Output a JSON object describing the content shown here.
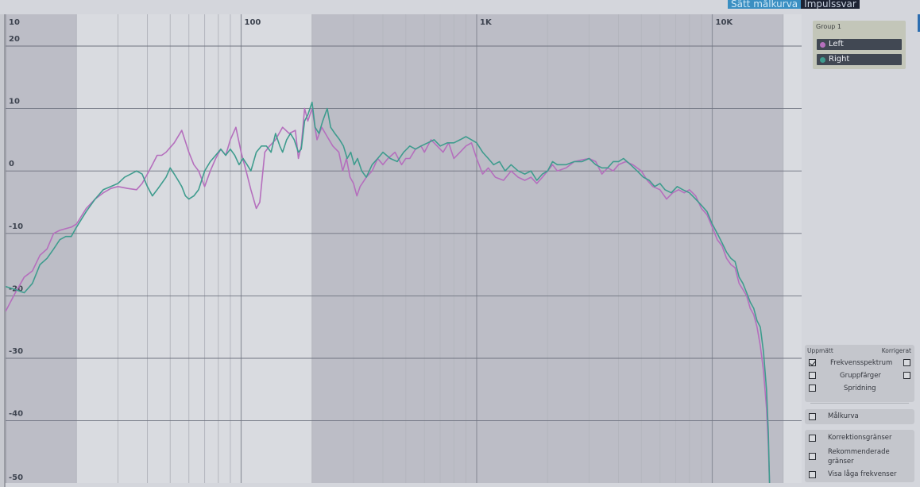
{
  "toolbar": {
    "target_curve_label": "Sätt målkurva",
    "impulse_label": "Impulssvar"
  },
  "chart_data": {
    "type": "line",
    "xscale": "log",
    "xlim": [
      10,
      20000
    ],
    "ylim": [
      -50,
      20
    ],
    "grid": true,
    "x_ticks": [
      {
        "value": 10,
        "label": "10"
      },
      {
        "value": 100,
        "label": "100"
      },
      {
        "value": 1000,
        "label": "1K"
      },
      {
        "value": 10000,
        "label": "10K"
      }
    ],
    "y_ticks": [
      {
        "value": 20,
        "label": "20"
      },
      {
        "value": 10,
        "label": "10"
      },
      {
        "value": 0,
        "label": "0"
      },
      {
        "value": -10,
        "label": "-10"
      },
      {
        "value": -20,
        "label": "-20"
      },
      {
        "value": -30,
        "label": "-30"
      },
      {
        "value": -40,
        "label": "-40"
      },
      {
        "value": -50,
        "label": "-50"
      }
    ],
    "shaded_regions": [
      [
        10,
        20
      ],
      [
        200,
        20000
      ]
    ],
    "series": [
      {
        "name": "Left",
        "color": "#b56fbd",
        "points": [
          [
            10,
            -22.5
          ],
          [
            11,
            -19.5
          ],
          [
            12,
            -17
          ],
          [
            13,
            -16
          ],
          [
            14,
            -13.5
          ],
          [
            15,
            -12.5
          ],
          [
            16,
            -10
          ],
          [
            17,
            -9.5
          ],
          [
            19,
            -9
          ],
          [
            20,
            -8.5
          ],
          [
            22,
            -6
          ],
          [
            24,
            -4.5
          ],
          [
            26,
            -3.5
          ],
          [
            28,
            -2.8
          ],
          [
            30,
            -2.5
          ],
          [
            33,
            -2.8
          ],
          [
            36,
            -3
          ],
          [
            38,
            -2
          ],
          [
            40,
            -0.5
          ],
          [
            42,
            1
          ],
          [
            44,
            2.5
          ],
          [
            46,
            2.5
          ],
          [
            48,
            3
          ],
          [
            52,
            4.5
          ],
          [
            56,
            6.5
          ],
          [
            60,
            3
          ],
          [
            63,
            1
          ],
          [
            66,
            0
          ],
          [
            70,
            -2.5
          ],
          [
            74,
            0
          ],
          [
            78,
            2
          ],
          [
            82,
            3.5
          ],
          [
            86,
            2.5
          ],
          [
            90,
            5
          ],
          [
            95,
            7
          ],
          [
            100,
            3
          ],
          [
            105,
            0
          ],
          [
            110,
            -3
          ],
          [
            116,
            -6
          ],
          [
            120,
            -5
          ],
          [
            126,
            3
          ],
          [
            132,
            4
          ],
          [
            140,
            5
          ],
          [
            150,
            7
          ],
          [
            160,
            6
          ],
          [
            170,
            6.5
          ],
          [
            175,
            2
          ],
          [
            180,
            4
          ],
          [
            186,
            10
          ],
          [
            192,
            8
          ],
          [
            200,
            10
          ],
          [
            210,
            5
          ],
          [
            220,
            7
          ],
          [
            232,
            5.5
          ],
          [
            245,
            4
          ],
          [
            260,
            3
          ],
          [
            270,
            0
          ],
          [
            280,
            2
          ],
          [
            290,
            -1
          ],
          [
            300,
            -2
          ],
          [
            310,
            -4
          ],
          [
            320,
            -2.5
          ],
          [
            340,
            -1
          ],
          [
            360,
            0
          ],
          [
            380,
            2
          ],
          [
            400,
            1
          ],
          [
            420,
            2
          ],
          [
            450,
            3
          ],
          [
            480,
            1
          ],
          [
            500,
            2
          ],
          [
            520,
            2
          ],
          [
            550,
            3.5
          ],
          [
            580,
            4
          ],
          [
            600,
            3
          ],
          [
            640,
            5
          ],
          [
            680,
            4
          ],
          [
            720,
            3
          ],
          [
            760,
            4.5
          ],
          [
            800,
            2
          ],
          [
            850,
            3
          ],
          [
            900,
            4
          ],
          [
            950,
            4.5
          ],
          [
            1000,
            2
          ],
          [
            1060,
            -0.5
          ],
          [
            1120,
            0.5
          ],
          [
            1200,
            -1
          ],
          [
            1300,
            -1.5
          ],
          [
            1400,
            0
          ],
          [
            1500,
            -1
          ],
          [
            1600,
            -1.5
          ],
          [
            1700,
            -1
          ],
          [
            1800,
            -2
          ],
          [
            1900,
            -1
          ],
          [
            2000,
            0
          ],
          [
            2100,
            1
          ],
          [
            2200,
            0
          ],
          [
            2400,
            0.5
          ],
          [
            2600,
            1.5
          ],
          [
            2800,
            1.8
          ],
          [
            3000,
            2
          ],
          [
            3200,
            1.5
          ],
          [
            3400,
            -0.5
          ],
          [
            3600,
            0.5
          ],
          [
            3800,
            0
          ],
          [
            4000,
            1
          ],
          [
            4300,
            1.5
          ],
          [
            4600,
            1
          ],
          [
            5000,
            0
          ],
          [
            5300,
            -1.5
          ],
          [
            5600,
            -2.5
          ],
          [
            6000,
            -3
          ],
          [
            6400,
            -4.5
          ],
          [
            6800,
            -3.5
          ],
          [
            7200,
            -3
          ],
          [
            7600,
            -3.5
          ],
          [
            8000,
            -3
          ],
          [
            8500,
            -4
          ],
          [
            9000,
            -6
          ],
          [
            9500,
            -7
          ],
          [
            10000,
            -9
          ],
          [
            10500,
            -11
          ],
          [
            11000,
            -12
          ],
          [
            11500,
            -14
          ],
          [
            12000,
            -15
          ],
          [
            12500,
            -15.5
          ],
          [
            13000,
            -18
          ],
          [
            13500,
            -19
          ],
          [
            14000,
            -20
          ],
          [
            14500,
            -22
          ],
          [
            15000,
            -23
          ],
          [
            15500,
            -25
          ],
          [
            16000,
            -28
          ],
          [
            16500,
            -32
          ],
          [
            17000,
            -38
          ],
          [
            17300,
            -44
          ],
          [
            17500,
            -50
          ]
        ]
      },
      {
        "name": "Right",
        "color": "#3f9c8e",
        "points": [
          [
            10,
            -18.5
          ],
          [
            11,
            -19
          ],
          [
            12,
            -19.5
          ],
          [
            13,
            -18
          ],
          [
            14,
            -15
          ],
          [
            15,
            -14
          ],
          [
            16,
            -12.5
          ],
          [
            17,
            -11
          ],
          [
            18,
            -10.5
          ],
          [
            19,
            -10.5
          ],
          [
            20,
            -9
          ],
          [
            22,
            -6.5
          ],
          [
            24,
            -4.5
          ],
          [
            26,
            -3
          ],
          [
            28,
            -2.5
          ],
          [
            30,
            -2
          ],
          [
            32,
            -1
          ],
          [
            34,
            -0.5
          ],
          [
            36,
            0
          ],
          [
            38,
            -0.5
          ],
          [
            40,
            -2.5
          ],
          [
            42,
            -4
          ],
          [
            44,
            -3
          ],
          [
            46,
            -2
          ],
          [
            48,
            -1
          ],
          [
            50,
            0.5
          ],
          [
            52,
            -0.5
          ],
          [
            54,
            -1.5
          ],
          [
            56,
            -2.5
          ],
          [
            58,
            -4
          ],
          [
            60,
            -4.5
          ],
          [
            63,
            -4
          ],
          [
            66,
            -3
          ],
          [
            70,
            0
          ],
          [
            74,
            1.5
          ],
          [
            78,
            2.5
          ],
          [
            82,
            3.5
          ],
          [
            86,
            2.5
          ],
          [
            90,
            3.5
          ],
          [
            94,
            2.5
          ],
          [
            98,
            1
          ],
          [
            102,
            2
          ],
          [
            106,
            1
          ],
          [
            110,
            0
          ],
          [
            116,
            3
          ],
          [
            122,
            4
          ],
          [
            128,
            4
          ],
          [
            134,
            3
          ],
          [
            140,
            6
          ],
          [
            146,
            4
          ],
          [
            150,
            3
          ],
          [
            156,
            5
          ],
          [
            162,
            6
          ],
          [
            168,
            5
          ],
          [
            175,
            3
          ],
          [
            180,
            3.5
          ],
          [
            186,
            8
          ],
          [
            192,
            9
          ],
          [
            200,
            11
          ],
          [
            206,
            7
          ],
          [
            214,
            6
          ],
          [
            222,
            8
          ],
          [
            232,
            10
          ],
          [
            240,
            7
          ],
          [
            250,
            6
          ],
          [
            262,
            5
          ],
          [
            272,
            4
          ],
          [
            282,
            2
          ],
          [
            292,
            3
          ],
          [
            302,
            1
          ],
          [
            312,
            2
          ],
          [
            325,
            0
          ],
          [
            340,
            -1
          ],
          [
            360,
            1
          ],
          [
            380,
            2
          ],
          [
            400,
            3
          ],
          [
            430,
            2
          ],
          [
            460,
            1.5
          ],
          [
            490,
            3
          ],
          [
            520,
            4
          ],
          [
            550,
            3.5
          ],
          [
            580,
            4
          ],
          [
            620,
            4.5
          ],
          [
            660,
            5
          ],
          [
            700,
            4
          ],
          [
            750,
            4.5
          ],
          [
            800,
            4.5
          ],
          [
            850,
            5
          ],
          [
            900,
            5.5
          ],
          [
            950,
            5
          ],
          [
            1000,
            4.5
          ],
          [
            1060,
            3
          ],
          [
            1120,
            2
          ],
          [
            1180,
            1
          ],
          [
            1250,
            1.5
          ],
          [
            1320,
            0
          ],
          [
            1400,
            1
          ],
          [
            1500,
            0
          ],
          [
            1600,
            -0.5
          ],
          [
            1700,
            0
          ],
          [
            1800,
            -1.5
          ],
          [
            1900,
            -0.5
          ],
          [
            2000,
            0
          ],
          [
            2100,
            1.5
          ],
          [
            2200,
            1
          ],
          [
            2400,
            1
          ],
          [
            2600,
            1.5
          ],
          [
            2800,
            1.5
          ],
          [
            3000,
            2
          ],
          [
            3200,
            1
          ],
          [
            3400,
            0.5
          ],
          [
            3600,
            0.5
          ],
          [
            3800,
            1.5
          ],
          [
            4000,
            1.5
          ],
          [
            4200,
            2
          ],
          [
            4500,
            1
          ],
          [
            4800,
            0
          ],
          [
            5100,
            -1
          ],
          [
            5400,
            -1.5
          ],
          [
            5700,
            -2.5
          ],
          [
            6000,
            -2
          ],
          [
            6300,
            -3
          ],
          [
            6700,
            -3.5
          ],
          [
            7100,
            -2.5
          ],
          [
            7500,
            -3
          ],
          [
            8000,
            -3.5
          ],
          [
            8500,
            -4.5
          ],
          [
            9000,
            -5.5
          ],
          [
            9500,
            -6.5
          ],
          [
            10000,
            -8.5
          ],
          [
            10500,
            -10
          ],
          [
            11000,
            -11.5
          ],
          [
            11500,
            -13
          ],
          [
            12000,
            -14
          ],
          [
            12500,
            -14.5
          ],
          [
            13000,
            -17
          ],
          [
            13500,
            -18
          ],
          [
            14000,
            -19.5
          ],
          [
            14500,
            -21
          ],
          [
            15000,
            -22
          ],
          [
            15500,
            -24
          ],
          [
            16000,
            -25
          ],
          [
            16500,
            -29
          ],
          [
            17000,
            -35
          ],
          [
            17300,
            -42
          ],
          [
            17500,
            -50
          ]
        ]
      }
    ]
  },
  "legend": {
    "group_title": "Group 1",
    "items": [
      {
        "label": "Left",
        "color": "#b56fbd"
      },
      {
        "label": "Right",
        "color": "#3f9c8e"
      }
    ]
  },
  "options": {
    "measured_header": "Uppmätt",
    "corrected_header": "Korrigerat",
    "rows": [
      {
        "label": "Frekvensspektrum",
        "measured_checked": true,
        "corrected_checked": false
      },
      {
        "label": "Gruppfärger",
        "measured_checked": false,
        "corrected_checked": false
      },
      {
        "label": "Spridning",
        "measured_checked": false
      }
    ],
    "target_curve_label": "Målkurva",
    "target_curve_checked": false,
    "extra": [
      {
        "label": "Korrektionsgränser",
        "checked": false
      },
      {
        "label": "Rekommenderade gränser",
        "checked": false
      },
      {
        "label": "Visa låga frekvenser",
        "checked": false
      }
    ]
  }
}
